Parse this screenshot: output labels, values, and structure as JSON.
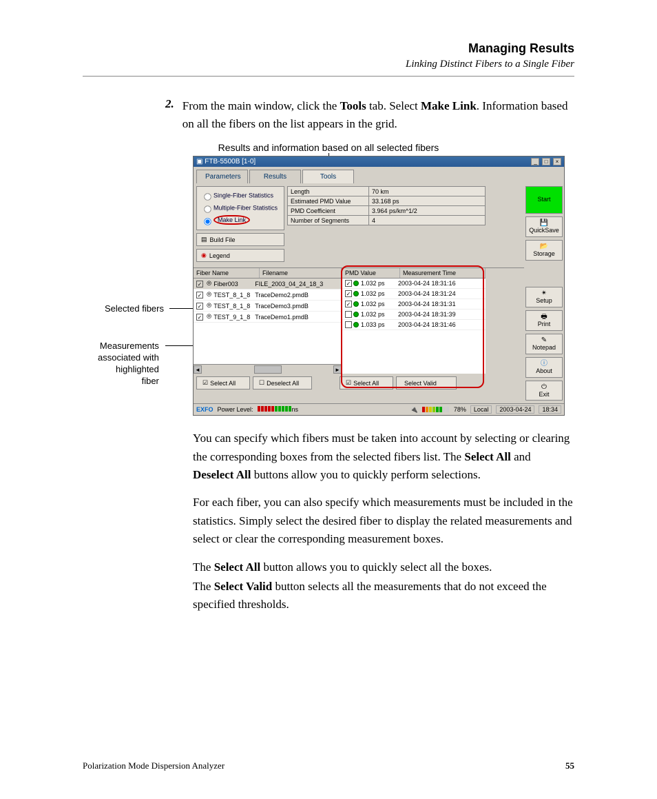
{
  "header": {
    "title": "Managing Results",
    "subtitle": "Linking Distinct Fibers to a Single Fiber"
  },
  "step": {
    "number": "2.",
    "prefix": "From the main window, click the ",
    "tools": "Tools",
    "mid": " tab. Select ",
    "makelink": "Make Link",
    "suffix": ". Information based on all the fibers on the list appears in the grid."
  },
  "caption": "Results and information based on all selected fibers",
  "side_labels": {
    "selected_fibers": "Selected fibers",
    "measurements": [
      "Measurements",
      "associated with",
      "highlighted",
      "fiber"
    ]
  },
  "shot": {
    "title": "FTB-5500B [1-0]",
    "tabs": {
      "parameters": "Parameters",
      "results": "Results",
      "tools": "Tools"
    },
    "radios": {
      "single": "Single-Fiber Statistics",
      "multi": "Multiple-Fiber Statistics",
      "make": "Make Link"
    },
    "left_buttons": {
      "build": "Build File",
      "legend": "Legend"
    },
    "info": [
      {
        "label": "Length",
        "value": "70 km"
      },
      {
        "label": "Estimated PMD Value",
        "value": "33.168 ps"
      },
      {
        "label": "PMD Coefficient",
        "value": "3.964 ps/km^1/2"
      },
      {
        "label": "Number of Segments",
        "value": "4"
      }
    ],
    "right_buttons": {
      "start": "Start",
      "quicksave": "QuickSave",
      "storage": "Storage",
      "setup": "Setup",
      "print": "Print",
      "notepad": "Notepad",
      "about": "About",
      "exit": "Exit"
    },
    "left_grid": {
      "headers": {
        "fiber": "Fiber Name",
        "file": "Filename"
      },
      "rows": [
        {
          "checked": true,
          "name": "Fiber003",
          "file": "FILE_2003_04_24_18_3",
          "hl": true
        },
        {
          "checked": true,
          "name": "TEST_8_1_8",
          "file": "TraceDemo2.pmdB"
        },
        {
          "checked": true,
          "name": "TEST_8_1_8",
          "file": "TraceDemo3.pmdB"
        },
        {
          "checked": true,
          "name": "TEST_9_1_8",
          "file": "TraceDemo1.pmdB"
        }
      ]
    },
    "right_grid": {
      "headers": {
        "pmd": "PMD Value",
        "time": "Measurement Time"
      },
      "rows": [
        {
          "checked": true,
          "pmd": "1.032 ps",
          "time": "2003-04-24 18:31:16"
        },
        {
          "checked": true,
          "pmd": "1.032 ps",
          "time": "2003-04-24 18:31:24"
        },
        {
          "checked": true,
          "pmd": "1.032 ps",
          "time": "2003-04-24 18:31:31"
        },
        {
          "checked": false,
          "pmd": "1.032 ps",
          "time": "2003-04-24 18:31:39"
        },
        {
          "checked": false,
          "pmd": "1.033 ps",
          "time": "2003-04-24 18:31:46"
        }
      ]
    },
    "sel_buttons": {
      "left_all": "Select All",
      "left_none": "Deselect All",
      "right_all": "Select All",
      "right_valid": "Select Valid"
    },
    "status": {
      "brand": "EXFO",
      "power_label": "Power Level:",
      "percent": "78%",
      "local": "Local",
      "date": "2003-04-24",
      "time": "18:34"
    }
  },
  "paras": {
    "p1a": "You can specify which fibers must be taken into account by selecting or clearing the corresponding boxes from the selected fibers list. The ",
    "p1b": "Select All",
    "p1c": " and ",
    "p1d": "Deselect All",
    "p1e": " buttons allow you to quickly perform selections.",
    "p2": "For each fiber, you can also specify which measurements must be included in the statistics. Simply select the desired fiber to display the related measurements and select or clear the corresponding measurement boxes.",
    "p3a": "The ",
    "p3b": "Select All",
    "p3c": " button allows you to quickly select all the boxes.",
    "p4a": "The ",
    "p4b": "Select Valid",
    "p4c": " button selects all the measurements that do not exceed the specified thresholds."
  },
  "footer": {
    "product": "Polarization Mode Dispersion Analyzer",
    "page": "55"
  }
}
